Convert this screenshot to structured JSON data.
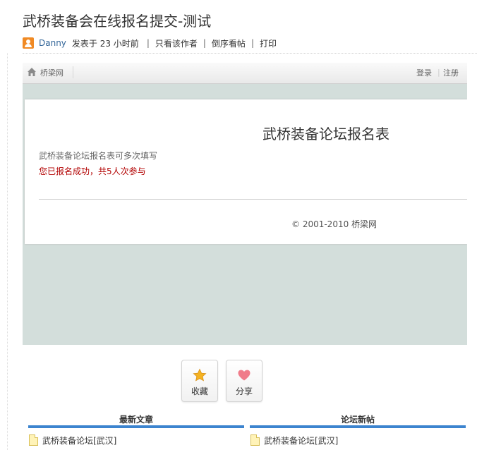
{
  "post": {
    "title": "武桥装备会在线报名提交-测试",
    "author": "Danny",
    "time": "发表于 23 小时前",
    "links": [
      "只看该作者",
      "倒序看帖",
      "打印"
    ]
  },
  "embed": {
    "site_name": "桥梁网",
    "login": "登录",
    "register": "注册",
    "login_sep": "|",
    "form_title": "武桥装备论坛报名表",
    "form_note": "武桥装备论坛报名表可多次填写",
    "form_success": "您已报名成功，共5人次参与",
    "copyright": "© 2001-2010 桥梁网"
  },
  "actions": {
    "favorite": "收藏",
    "share": "分享"
  },
  "sections": {
    "latest_articles": {
      "title": "最新文章",
      "items": [
        "武桥装备论坛[武汉]"
      ]
    },
    "forum_new_posts": {
      "title": "论坛新帖",
      "items": [
        "武桥装备论坛[武汉]"
      ]
    }
  },
  "colors": {
    "accent": "#3c84cf",
    "success_text": "#b20000",
    "avatar": "#f08a24",
    "embed_bg": "#d3dedb",
    "author_link": "#336699"
  },
  "icons": [
    "user-avatar-icon",
    "home-icon",
    "star-icon",
    "heart-icon",
    "document-icon"
  ]
}
